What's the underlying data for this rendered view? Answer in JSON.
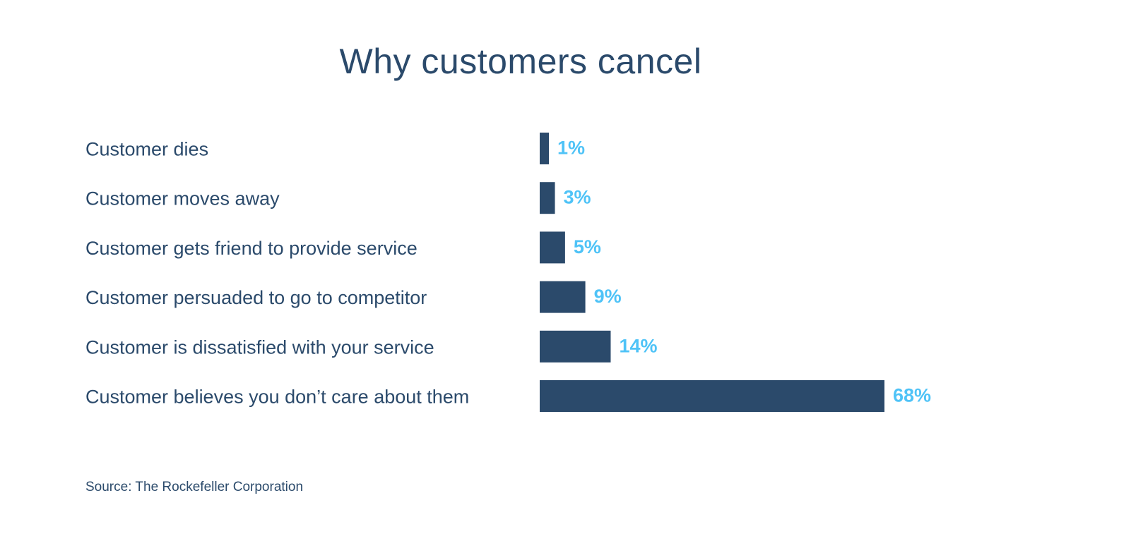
{
  "chart_data": {
    "type": "bar",
    "orientation": "horizontal",
    "title": "Why customers cancel",
    "categories": [
      "Customer dies",
      "Customer moves away",
      "Customer gets friend to provide service",
      "Customer persuaded to go to competitor",
      "Customer is dissatisfied with your service",
      "Customer believes you don’t care about them"
    ],
    "values": [
      1,
      3,
      5,
      9,
      14,
      68
    ],
    "value_labels": [
      "1%",
      "3%",
      "5%",
      "9%",
      "14%",
      "68%"
    ],
    "unit": "%",
    "xlabel": "",
    "ylabel": "",
    "xlim": [
      0,
      68
    ],
    "grid": false,
    "legend": "none",
    "bar_color": "#2b4a6b",
    "label_color": "#4fc3f7",
    "source": "Source: The Rockefeller Corporation"
  }
}
